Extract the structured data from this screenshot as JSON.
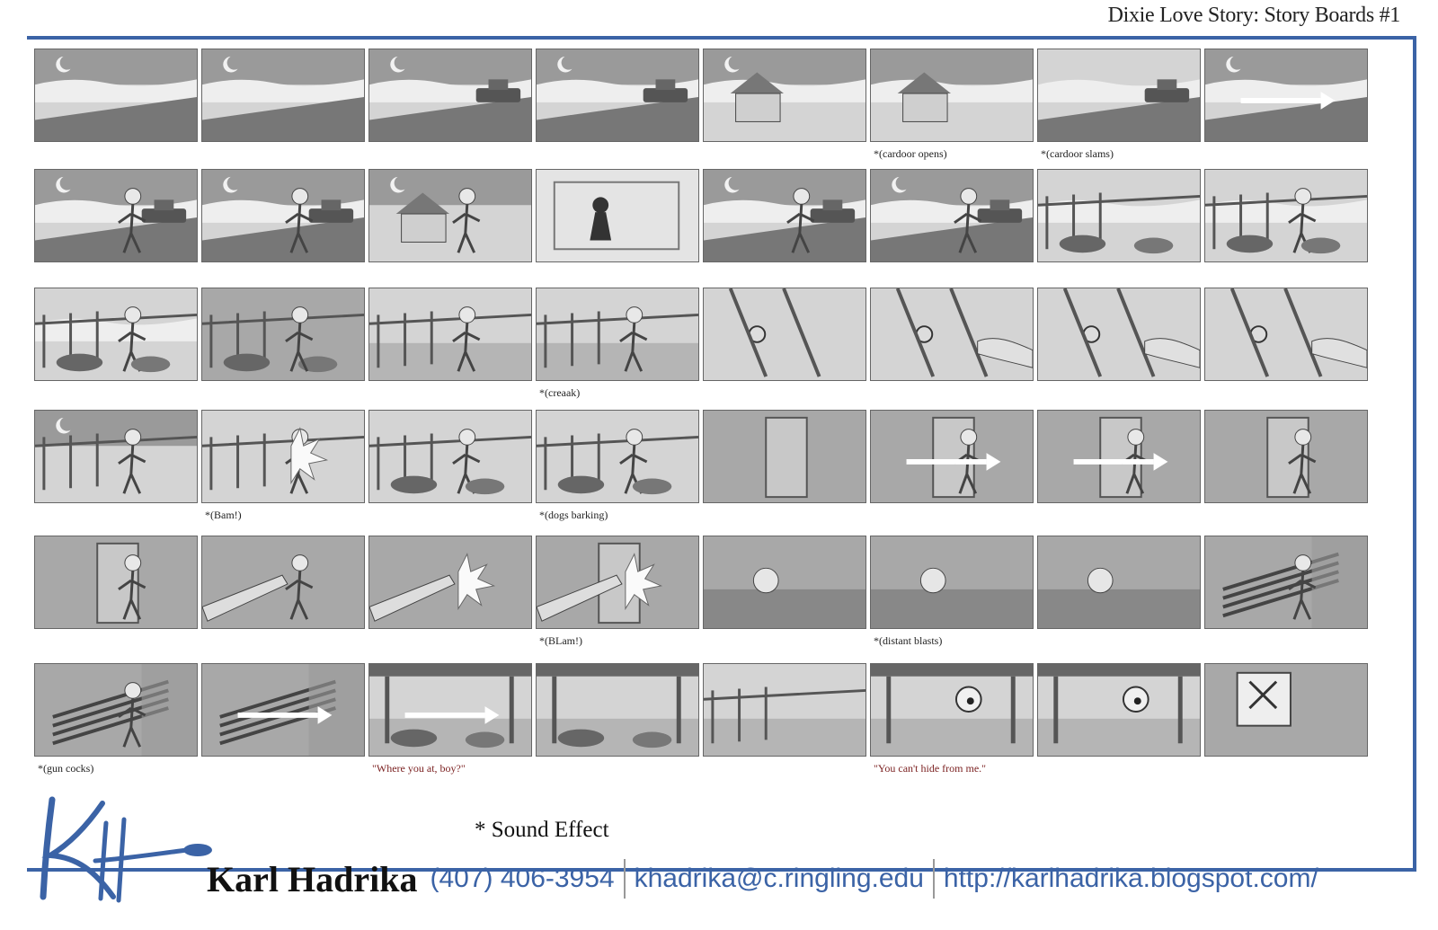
{
  "header": {
    "title": "Dixie Love Story: Story Boards #1"
  },
  "rows": [
    {
      "panels": [
        {
          "scene": "night-road-moon"
        },
        {
          "scene": "night-road-moon"
        },
        {
          "scene": "truck-headlights"
        },
        {
          "scene": "truck-approach"
        },
        {
          "scene": "house-no-trespassin"
        },
        {
          "scene": "house-closeup",
          "caption": "*(cardoor opens)"
        },
        {
          "scene": "road-truck-parked",
          "caption": "*(cardoor slams)"
        },
        {
          "scene": "road-swoosh"
        }
      ]
    },
    {
      "panels": [
        {
          "scene": "man-truck-road"
        },
        {
          "scene": "man-surprised"
        },
        {
          "scene": "shack-window-man"
        },
        {
          "scene": "window-silhouette"
        },
        {
          "scene": "man-truck-road"
        },
        {
          "scene": "man-truck-road"
        },
        {
          "scene": "porch-dogs"
        },
        {
          "scene": "porch-man-sneak"
        }
      ]
    },
    {
      "panels": [
        {
          "scene": "porch-man-dogs"
        },
        {
          "scene": "porch-door-dogs"
        },
        {
          "scene": "feet-porch"
        },
        {
          "scene": "feet-porch-creak",
          "caption": "*(creaak)"
        },
        {
          "scene": "door-knob"
        },
        {
          "scene": "door-knob-hand"
        },
        {
          "scene": "door-knob-hand"
        },
        {
          "scene": "door-knob-turn"
        }
      ]
    },
    {
      "panels": [
        {
          "scene": "man-fall-railing"
        },
        {
          "scene": "man-tumble",
          "caption": "*(Bam!)"
        },
        {
          "scene": "man-porch-dogs"
        },
        {
          "scene": "man-porch-dogs",
          "caption": "*(dogs barking)"
        },
        {
          "scene": "interior-door"
        },
        {
          "scene": "interior-man-enter"
        },
        {
          "scene": "interior-man-walk"
        },
        {
          "scene": "man-door-close"
        }
      ]
    },
    {
      "panels": [
        {
          "scene": "man-door-lean"
        },
        {
          "scene": "gun-barrel-man"
        },
        {
          "scene": "gun-blast"
        },
        {
          "scene": "gun-blast-door",
          "caption": "*(BLam!)"
        },
        {
          "scene": "girl-bed"
        },
        {
          "scene": "girl-bed-awake",
          "caption": "*(distant blasts)"
        },
        {
          "scene": "girl-bed-scared"
        },
        {
          "scene": "girl-rifles"
        }
      ]
    },
    {
      "panels": [
        {
          "scene": "girl-rifles",
          "caption": "*(gun cocks)"
        },
        {
          "scene": "rifles-arrow"
        },
        {
          "scene": "under-table-arrow",
          "caption": "\"Where you at, boy?\"",
          "dialog": true
        },
        {
          "scene": "under-table"
        },
        {
          "scene": "floor-closeup"
        },
        {
          "scene": "under-table-eye",
          "caption": "\"You can't hide from me.\"",
          "dialog": true
        },
        {
          "scene": "under-table-face"
        },
        {
          "scene": "window-flag"
        }
      ]
    }
  ],
  "legend": {
    "sound_effect": "* Sound Effect"
  },
  "footer": {
    "name": "Karl Hadrika",
    "phone": "(407) 406-3954",
    "email": "khadrika@c.ringling.edu",
    "url": "http://karlhadrika.blogspot.com/"
  },
  "colors": {
    "accent": "#3b63a6",
    "dialog": "#7a1f1f"
  }
}
